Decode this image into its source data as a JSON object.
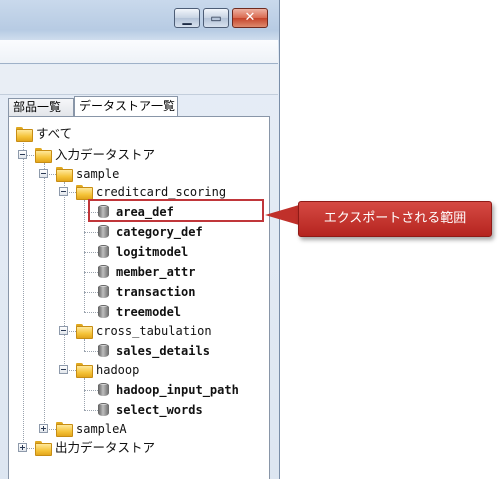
{
  "window": {
    "buttons": {
      "minimize": "▁",
      "maximize": "▭",
      "close": "✕"
    }
  },
  "tabs": [
    {
      "label": "部品一覧",
      "active": false
    },
    {
      "label": "データストア一覧",
      "active": true
    }
  ],
  "tree": {
    "root": "すべて",
    "input_store": "入力データストア",
    "sample": "sample",
    "creditcard_scoring": "creditcard_scoring",
    "creditcard_items": [
      "area_def",
      "category_def",
      "logitmodel",
      "member_attr",
      "transaction",
      "treemodel"
    ],
    "cross_tabulation": "cross_tabulation",
    "cross_items": [
      "sales_details"
    ],
    "hadoop": "hadoop",
    "hadoop_items": [
      "hadoop_input_path",
      "select_words"
    ],
    "sampleA": "sampleA",
    "output_store": "出力データストア"
  },
  "callout": {
    "text": "エクスポートされる範囲",
    "color": "#c0302a"
  },
  "highlight_color": "#c0363a",
  "icons": {
    "folder": "folder-icon",
    "datastore": "database-icon",
    "expand": "expand-icon",
    "collapse": "collapse-icon"
  }
}
